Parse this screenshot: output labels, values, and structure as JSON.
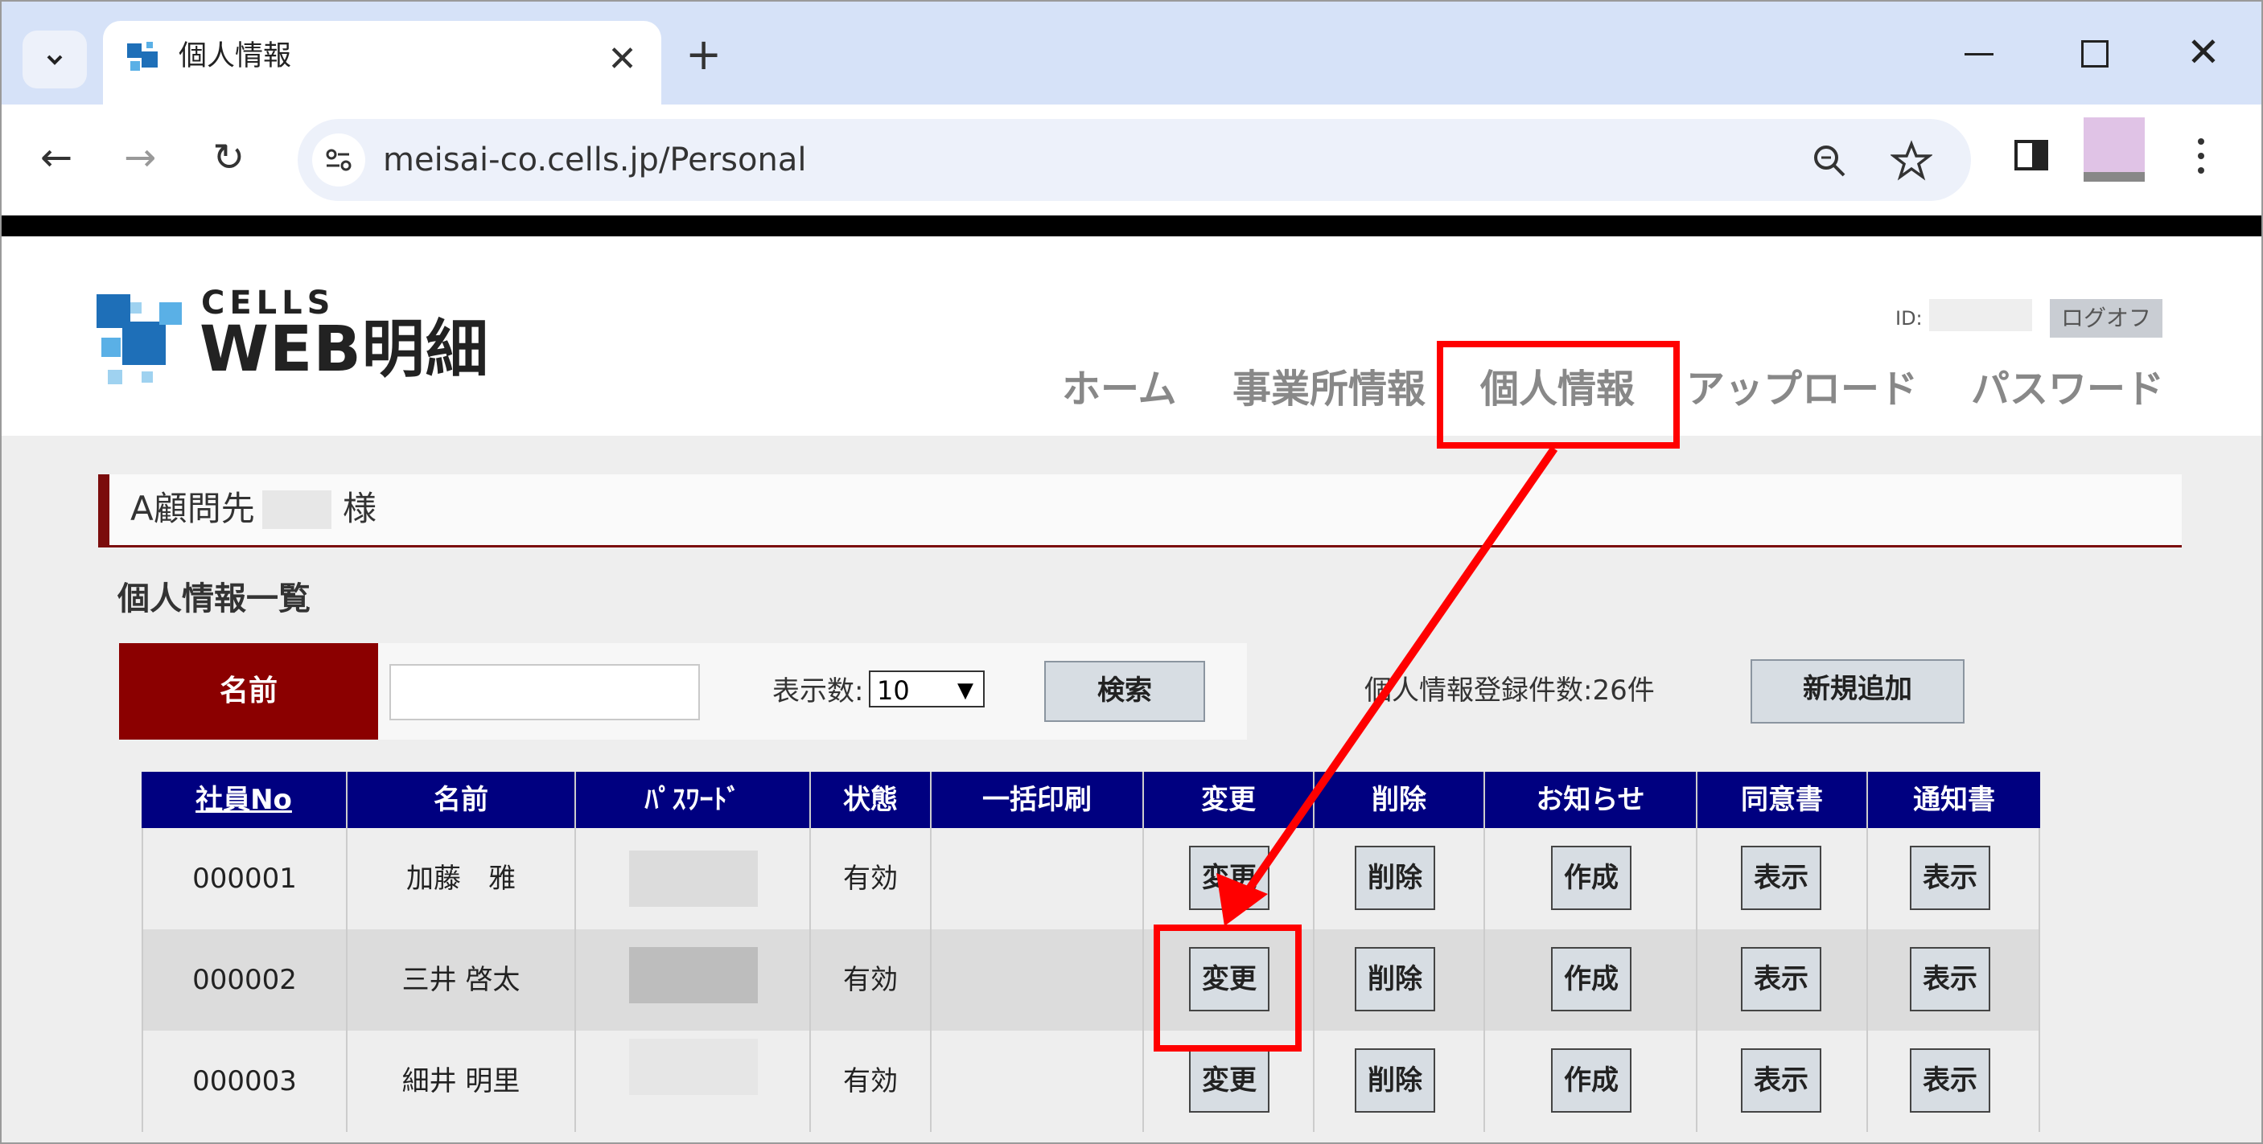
{
  "browser": {
    "tab_title": "個人情報",
    "url": "meisai-co.cells.jp/Personal",
    "new_tab": "+",
    "tab_close": "✕",
    "back": "←",
    "forward": "→",
    "reload": "↻"
  },
  "header": {
    "logo_small": "CELLS",
    "logo_main": "WEB明細",
    "id_label": "ID:",
    "logoff": "ログオフ",
    "nav": [
      "ホーム",
      "事業所情報",
      "個人情報",
      "アップロード",
      "パスワード"
    ]
  },
  "client": {
    "name_prefix": "A顧問先",
    "suffix": "様"
  },
  "section_title": "個人情報一覧",
  "search": {
    "name_label": "名前",
    "name_value": "",
    "display_count_label": "表示数:",
    "display_count_value": "10",
    "search_button": "検索",
    "record_count": "個人情報登録件数:26件",
    "add_button": "新規追加"
  },
  "table": {
    "headers": [
      "社員No",
      "名前",
      "ﾊﾟｽﾜｰﾄﾞ",
      "状態",
      "一括印刷",
      "変更",
      "削除",
      "お知らせ",
      "同意書",
      "通知書"
    ],
    "rows": [
      {
        "no": "000001",
        "name": "加藤　雅",
        "status": "有効",
        "change": "変更",
        "delete": "削除",
        "notice": "作成",
        "consent": "表示",
        "notification": "表示"
      },
      {
        "no": "000002",
        "name": "三井 啓太",
        "status": "有効",
        "change": "変更",
        "delete": "削除",
        "notice": "作成",
        "consent": "表示",
        "notification": "表示"
      },
      {
        "no": "000003",
        "name": "細井 明里",
        "status": "有効",
        "change": "変更",
        "delete": "削除",
        "notice": "作成",
        "consent": "表示",
        "notification": "表示"
      }
    ]
  },
  "colors": {
    "accent_red": "#8b0000",
    "table_header": "#000080",
    "annotation": "#ff0000"
  }
}
